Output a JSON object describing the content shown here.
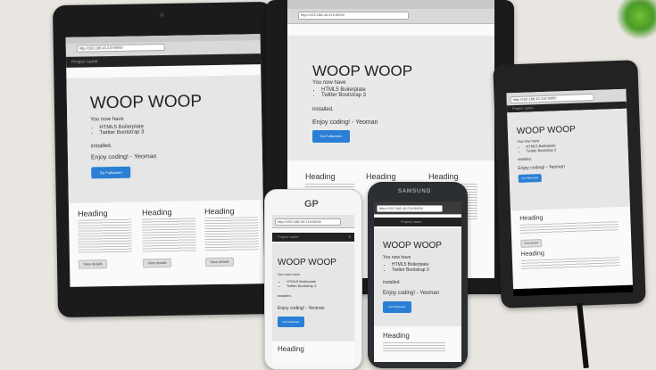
{
  "scene": {
    "description_items": [
      "tablet-left",
      "tablet-center",
      "tablet-right",
      "phone-white",
      "phone-samsung"
    ]
  },
  "site": {
    "title": "WOOP WOOP",
    "lead": "You now have",
    "items": [
      "HTML5 Boilerplate",
      "Twitter Bootstrap 3"
    ],
    "installed": "installed.",
    "enjoy": "Enjoy coding! - Yeoman",
    "button": "Go Fullscreen",
    "heading": "Heading",
    "view": "View details",
    "brand": "Project name",
    "url": "http://192.168.43.219:9000/"
  },
  "brands": {
    "samsung": "SAMSUNG",
    "gp": "GP"
  },
  "colors": {
    "primary_button": "#2a7fd4",
    "navbar": "#222222",
    "jumbotron": "#e6e6e6",
    "device_black": "#1b1b1b",
    "table": "#e9e6e1"
  }
}
